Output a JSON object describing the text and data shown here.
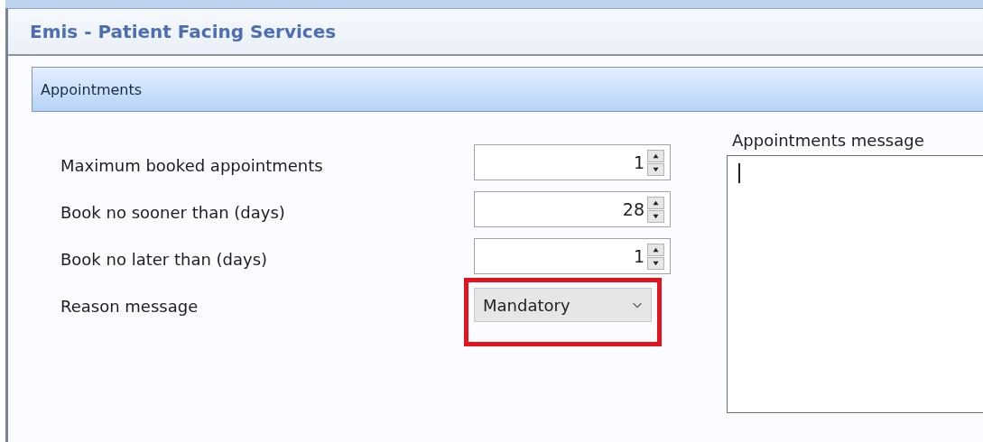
{
  "window": {
    "title": "Emis - Patient Facing Services"
  },
  "section": {
    "title": "Appointments"
  },
  "fields": [
    {
      "kind": "spin",
      "label": "Maximum booked appointments",
      "value": "1"
    },
    {
      "kind": "spin",
      "label": "Book no sooner than (days)",
      "value": "28"
    },
    {
      "kind": "spin",
      "label": "Book no later than (days)",
      "value": "1"
    },
    {
      "kind": "dropdown",
      "label": "Reason message",
      "value": "Mandatory",
      "highlighted": true
    }
  ],
  "message": {
    "label": "Appointments message",
    "focused": true
  }
}
